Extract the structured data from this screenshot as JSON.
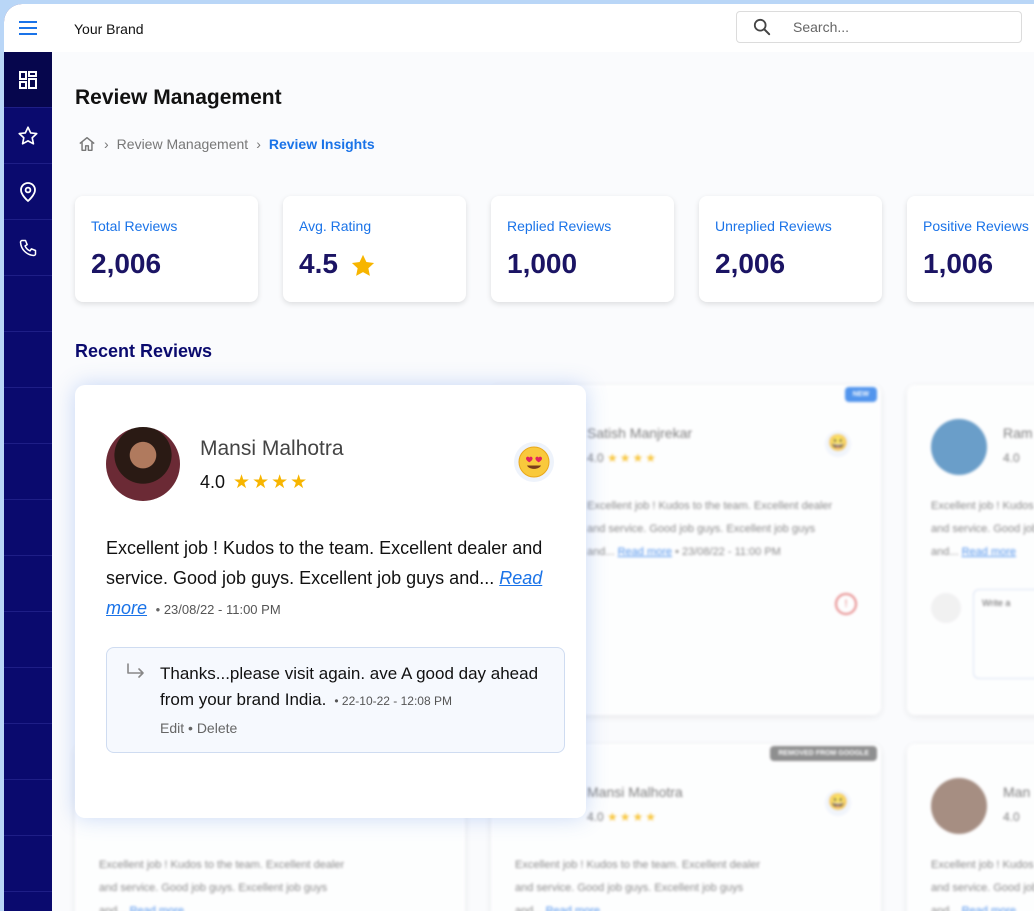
{
  "topbar": {
    "brand": "Your Brand",
    "search_placeholder": "Search..."
  },
  "sidebar": {
    "items": [
      "menu-icon",
      "dashboard-icon",
      "star-icon",
      "location-icon",
      "phone-icon"
    ]
  },
  "page": {
    "title": "Review Management"
  },
  "breadcrumb": {
    "items": [
      "Review Management",
      "Review Insights"
    ]
  },
  "stats": [
    {
      "label": "Total Reviews",
      "value": "2,006"
    },
    {
      "label": "Avg. Rating",
      "value": "4.5"
    },
    {
      "label": "Replied Reviews",
      "value": "1,000"
    },
    {
      "label": "Unreplied Reviews",
      "value": "2,006"
    },
    {
      "label": "Positive Reviews",
      "value": "1,006"
    }
  ],
  "recent": {
    "title": "Recent Reviews",
    "featured": {
      "name": "Mansi Malhotra",
      "rating": "4.0",
      "stars": 4,
      "text": "Excellent job ! Kudos to the team. Excellent dealer and service. Good job guys. Excellent job guys and...",
      "read_more": "Read more",
      "timestamp": "23/08/22 - 11:00 PM",
      "reply": {
        "text": "Thanks...please visit again. ave A good day ahead from your brand India.",
        "timestamp": "22-10-22 - 12:08 PM",
        "edit": "Edit",
        "delete": "Delete"
      }
    },
    "background_cards": [
      {
        "name": "Satish Manjrekar",
        "rating": "4.0",
        "badge": "NEW"
      },
      {
        "name": "Ram",
        "rating": "4.0"
      },
      {
        "name": "Mansi Malhotra",
        "rating": "4.0",
        "badge": "REMOVED FROM GOOGLE"
      },
      {
        "name": "Man",
        "rating": "4.0"
      }
    ],
    "bg_text_line1": "Excellent job ! Kudos to the team. Excellent dealer",
    "bg_text_line2": "and service. Good job guys. Excellent job guys",
    "bg_text_line3": "and...",
    "bg_readmore": "Read more",
    "bg_ts_1": "23/08/22 - 11:00 PM",
    "bg_write": "Write a"
  },
  "colors": {
    "sidebar": "#0a0a6e",
    "accent": "#1a73e8",
    "stat_value": "#1b1464",
    "star": "#f7b500"
  }
}
